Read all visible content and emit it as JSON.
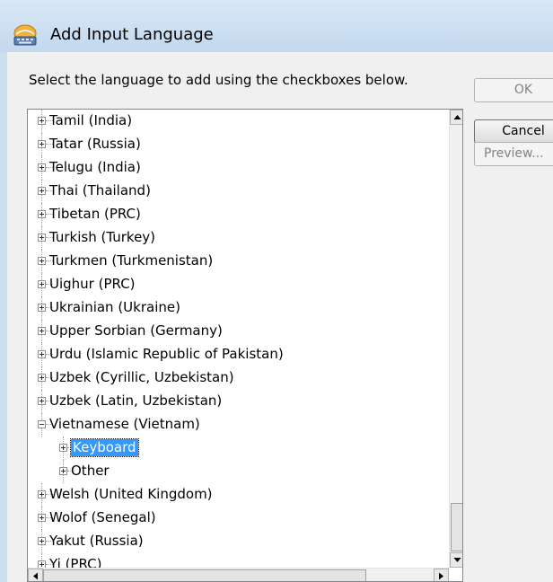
{
  "window": {
    "title": "Add Input Language",
    "title_icon": "keyboard-globe-icon"
  },
  "prompt": "Select the language to add using the checkboxes below.",
  "buttons": {
    "ok": "OK",
    "cancel": "Cancel",
    "preview": "Preview..."
  },
  "tree": {
    "rows": [
      {
        "label": "Tamil (India)",
        "level": 0,
        "expander": "plus"
      },
      {
        "label": "Tatar (Russia)",
        "level": 0,
        "expander": "plus"
      },
      {
        "label": "Telugu (India)",
        "level": 0,
        "expander": "plus"
      },
      {
        "label": "Thai (Thailand)",
        "level": 0,
        "expander": "plus"
      },
      {
        "label": "Tibetan (PRC)",
        "level": 0,
        "expander": "plus"
      },
      {
        "label": "Turkish (Turkey)",
        "level": 0,
        "expander": "plus"
      },
      {
        "label": "Turkmen (Turkmenistan)",
        "level": 0,
        "expander": "plus"
      },
      {
        "label": "Uighur (PRC)",
        "level": 0,
        "expander": "plus"
      },
      {
        "label": "Ukrainian (Ukraine)",
        "level": 0,
        "expander": "plus"
      },
      {
        "label": "Upper Sorbian (Germany)",
        "level": 0,
        "expander": "plus"
      },
      {
        "label": "Urdu (Islamic Republic of Pakistan)",
        "level": 0,
        "expander": "plus"
      },
      {
        "label": "Uzbek (Cyrillic, Uzbekistan)",
        "level": 0,
        "expander": "plus"
      },
      {
        "label": "Uzbek (Latin, Uzbekistan)",
        "level": 0,
        "expander": "plus"
      },
      {
        "label": "Vietnamese (Vietnam)",
        "level": 0,
        "expander": "minus"
      },
      {
        "label": "Keyboard",
        "level": 1,
        "expander": "plus",
        "selected": true
      },
      {
        "label": "Other",
        "level": 1,
        "expander": "plus"
      },
      {
        "label": "Welsh (United Kingdom)",
        "level": 0,
        "expander": "plus"
      },
      {
        "label": "Wolof (Senegal)",
        "level": 0,
        "expander": "plus"
      },
      {
        "label": "Yakut (Russia)",
        "level": 0,
        "expander": "plus"
      },
      {
        "label": "Yi (PRC)",
        "level": 0,
        "expander": "plus"
      }
    ]
  },
  "colors": {
    "selection": "#3399ff",
    "titlebar": "#c3d8ee"
  }
}
